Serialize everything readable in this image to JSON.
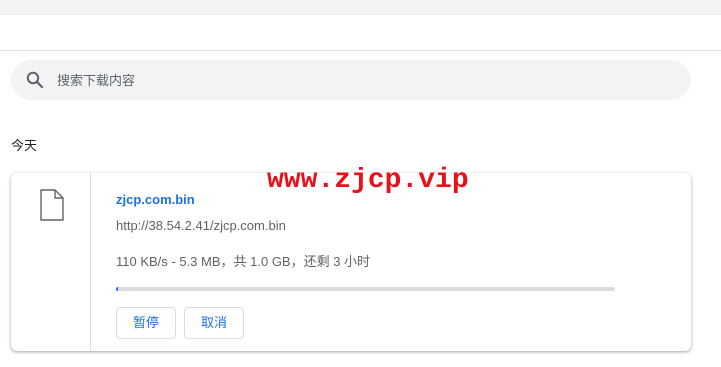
{
  "search": {
    "placeholder": "搜索下载内容",
    "value": ""
  },
  "sections": [
    {
      "heading": "今天",
      "downloads": [
        {
          "file_name": "zjcp.com.bin",
          "url": "http://38.54.2.41/zjcp.com.bin",
          "status": "110 KB/s - 5.3 MB，共 1.0 GB，还剩 3 小时",
          "progress_fraction": 0.005,
          "pause_label": "暂停",
          "cancel_label": "取消"
        }
      ]
    }
  ],
  "watermark": "www.zjcp.vip",
  "colors": {
    "accent": "#1a73e8",
    "search_background": "#f1f3f4",
    "divider": "#dadce0",
    "watermark": "#e8101a"
  },
  "icons": {
    "search": "search-icon",
    "file": "file-icon"
  }
}
